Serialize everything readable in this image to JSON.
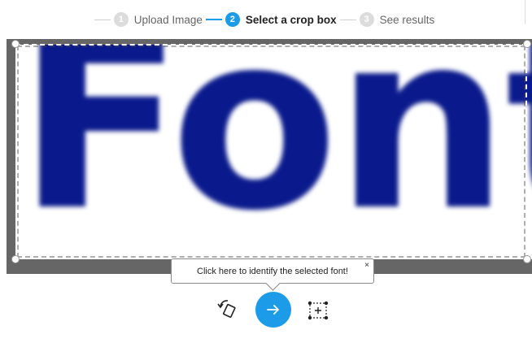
{
  "stepper": {
    "steps": [
      {
        "number": "1",
        "label": "Upload Image",
        "state": "done"
      },
      {
        "number": "2",
        "label": "Select a crop box",
        "state": "active"
      },
      {
        "number": "3",
        "label": "See results",
        "state": "pending"
      }
    ]
  },
  "image": {
    "text": "Font",
    "text_color": "#0a1a8c"
  },
  "tooltip": {
    "text": "Click here to identify the selected font!",
    "close_label": "×"
  },
  "toolbar": {
    "rotate_icon": "rotate-icon",
    "go_icon": "arrow-right-icon",
    "crop_icon": "add-crop-box-icon",
    "accent": "#1b9be8"
  }
}
